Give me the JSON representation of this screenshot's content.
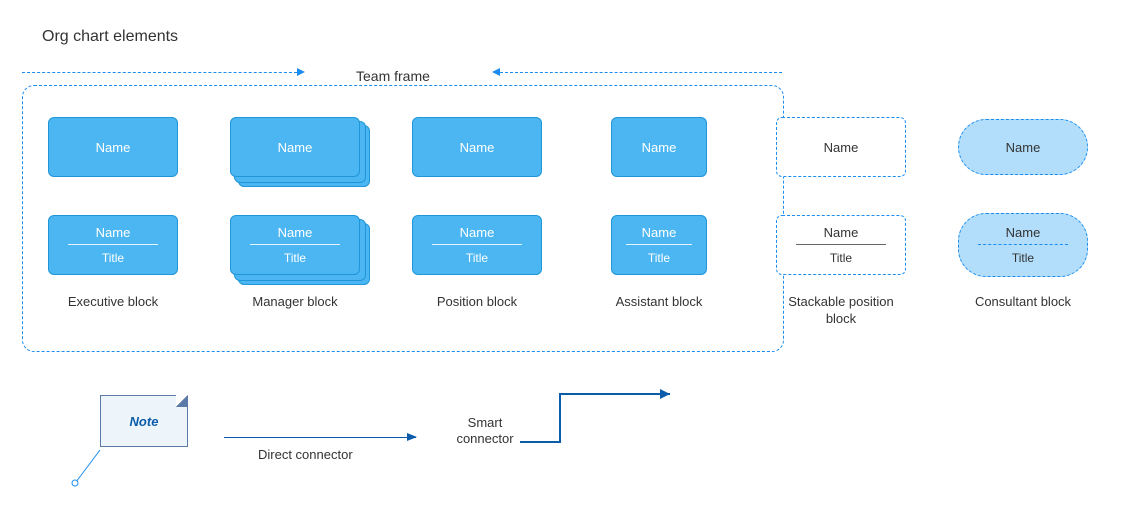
{
  "page_title": "Org chart elements",
  "team_frame_label": "Team frame",
  "placeholder": {
    "name": "Name",
    "title": "Title"
  },
  "columns": [
    {
      "caption": "Executive block",
      "type": "executive",
      "small": false
    },
    {
      "caption": "Manager block",
      "type": "manager",
      "small": false
    },
    {
      "caption": "Position block",
      "type": "position",
      "small": false
    },
    {
      "caption": "Assistant block",
      "type": "assistant",
      "small": true
    },
    {
      "caption": "Stackable position block",
      "type": "stackable",
      "small": false
    },
    {
      "caption": "Consultant block",
      "type": "consultant",
      "small": false
    }
  ],
  "note_label": "Note",
  "direct_connector_label": "Direct connector",
  "smart_connector_label": "Smart\nconnector",
  "colors": {
    "block_fill": "#4cb6f2",
    "block_border": "#1e96d8",
    "dash_border": "#1c8df0",
    "oval_fill": "#b2defb",
    "note_fill": "#eef5fa",
    "note_border": "#5c7aa8",
    "connector": "#0b5cab"
  }
}
